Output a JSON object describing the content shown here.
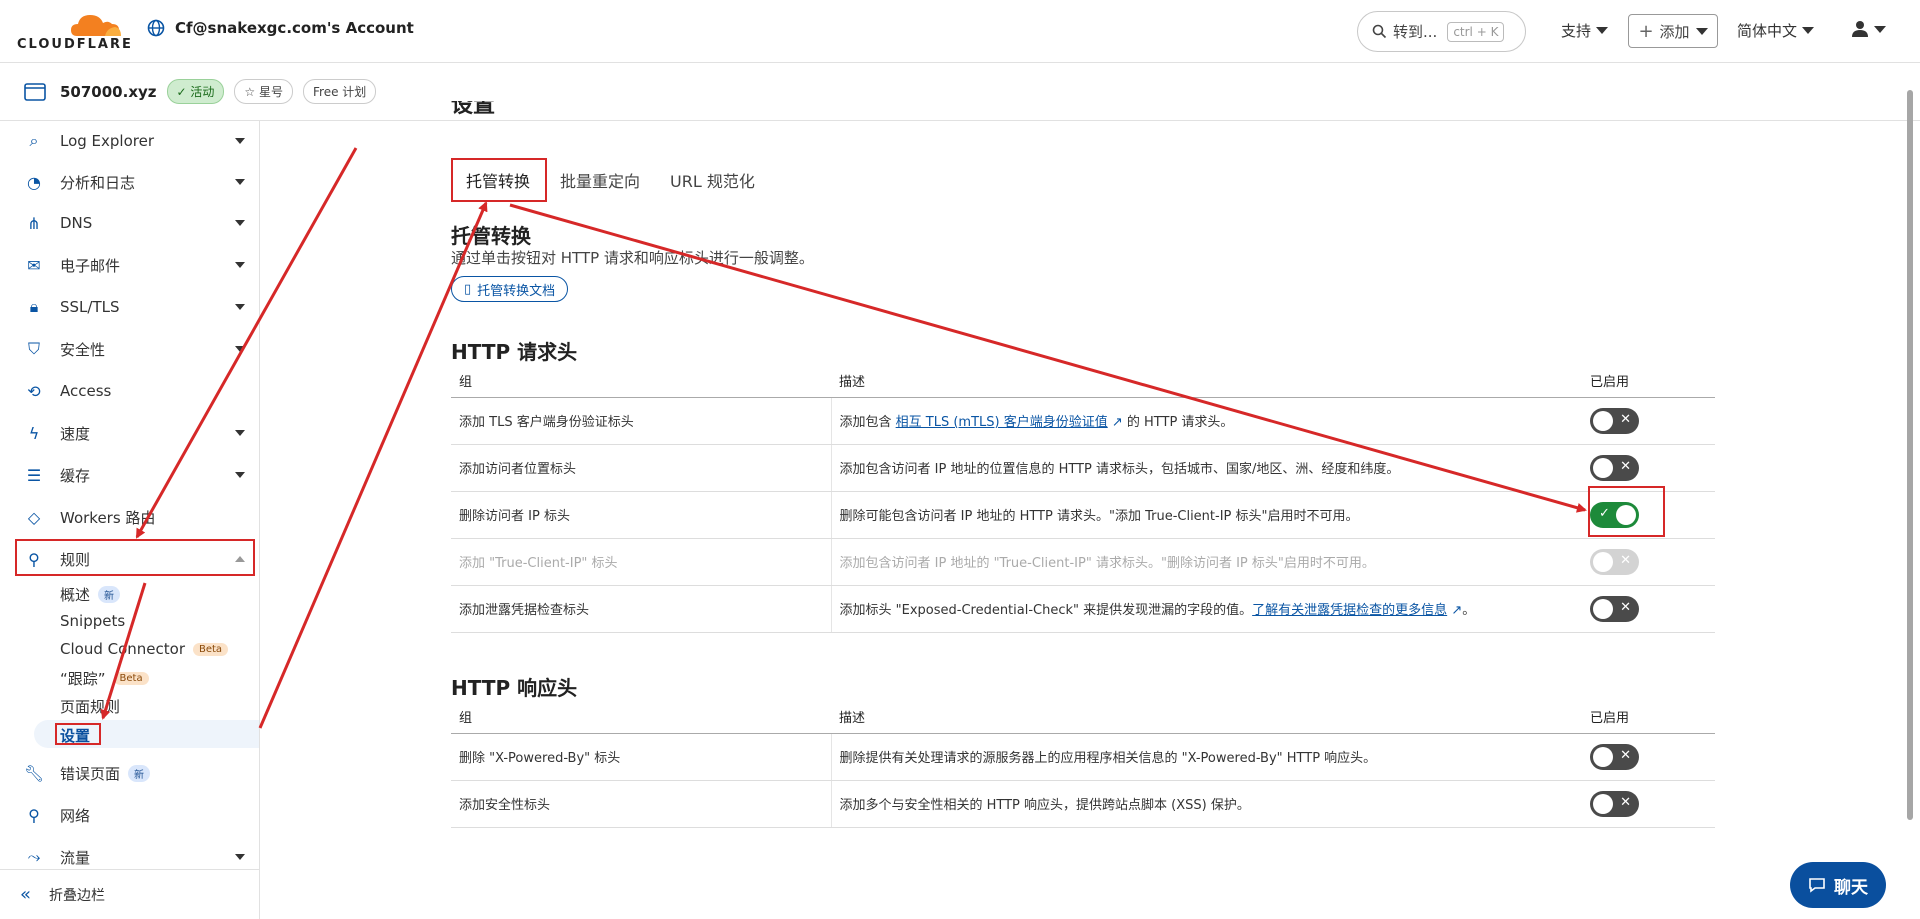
{
  "header": {
    "logo_text": "CLOUDFLARE",
    "account": "Cf@snakexgc.com's Account",
    "search_label": "转到...",
    "search_shortcut": "ctrl + K",
    "support": "支持",
    "add": "添加",
    "language": "简体中文"
  },
  "zone": {
    "name": "507000.xyz",
    "status": "活动",
    "star": "星号",
    "plan": "Free 计划"
  },
  "sidebar": {
    "items": [
      {
        "label": "Log Explorer"
      },
      {
        "label": "分析和日志"
      },
      {
        "label": "DNS"
      },
      {
        "label": "电子邮件"
      },
      {
        "label": "SSL/TLS"
      },
      {
        "label": "安全性"
      },
      {
        "label": "Access"
      },
      {
        "label": "速度"
      },
      {
        "label": "缓存"
      },
      {
        "label": "Workers 路由"
      },
      {
        "label": "规则"
      },
      {
        "label": "错误页面",
        "badge": "新"
      },
      {
        "label": "网络"
      },
      {
        "label": "流量"
      }
    ],
    "rules_sub": [
      {
        "label": "概述",
        "badge": "新"
      },
      {
        "label": "Snippets"
      },
      {
        "label": "Cloud Connector",
        "badge": "Beta"
      },
      {
        "label": "“跟踪”",
        "badge": "Beta"
      },
      {
        "label": "页面规则"
      },
      {
        "label": "设置"
      }
    ],
    "collapse": "折叠边栏"
  },
  "main": {
    "partial_heading": "设置",
    "tabs": [
      {
        "label": "托管转换"
      },
      {
        "label": "批量重定向"
      },
      {
        "label": "URL 规范化"
      }
    ],
    "section_title": "托管转换",
    "section_desc": "通过单击按钮对 HTTP 请求和响应标头进行一般调整。",
    "doc_button": "托管转换文档",
    "request_title": "HTTP 请求头",
    "response_title": "HTTP 响应头",
    "col_group": "组",
    "col_desc": "描述",
    "col_enabled": "已启用",
    "request_rows": [
      {
        "group": "添加 TLS 客户端身份验证标头",
        "desc_pre": "添加包含 ",
        "desc_link": "相互 TLS (mTLS) 客户端身份验证值",
        "desc_post": " 的 HTTP 请求头。",
        "state": "off"
      },
      {
        "group": "添加访问者位置标头",
        "desc": "添加包含访问者 IP 地址的位置信息的 HTTP 请求标头，包括城市、国家/地区、洲、经度和纬度。",
        "state": "off"
      },
      {
        "group": "删除访问者 IP 标头",
        "desc": "删除可能包含访问者 IP 地址的 HTTP 请求头。\"添加 True-Client-IP 标头\"启用时不可用。",
        "state": "on"
      },
      {
        "group": "添加 \"True-Client-IP\" 标头",
        "desc": "添加包含访问者 IP 地址的 \"True-Client-IP\" 请求标头。\"删除访问者 IP 标头\"启用时不可用。",
        "state": "disabled"
      },
      {
        "group": "添加泄露凭据检查标头",
        "desc_pre": "添加标头 \"Exposed-Credential-Check\" 来提供发现泄漏的字段的值。",
        "desc_link": "了解有关泄露凭据检查的更多信息",
        "desc_post": "。",
        "state": "off"
      }
    ],
    "response_rows": [
      {
        "group": "删除 \"X-Powered-By\" 标头",
        "desc": "删除提供有关处理请求的源服务器上的应用程序相关信息的 \"X-Powered-By\" HTTP 响应头。",
        "state": "off"
      },
      {
        "group": "添加安全性标头",
        "desc": "添加多个与安全性相关的 HTTP 响应头，提供跨站点脚本 (XSS) 保护。",
        "state": "off"
      }
    ]
  },
  "chat": {
    "label": "聊天"
  },
  "colors": {
    "accent": "#0a55a4",
    "toggle_on": "#1d8a3a",
    "toggle_off": "#4a4a4a",
    "annotation": "#d62828",
    "brand_orange": "#f38020"
  }
}
